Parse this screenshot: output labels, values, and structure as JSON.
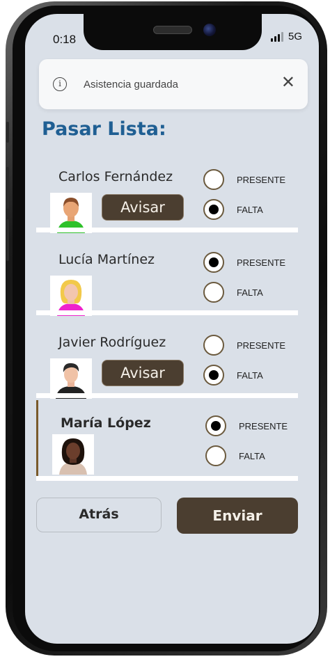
{
  "status_bar": {
    "time": "0:18",
    "network": "5G"
  },
  "toast": {
    "message": "Asistencia guardada",
    "info_glyph": "i",
    "close_glyph": "✕"
  },
  "page_title": "Pasar Lista:",
  "option_labels": {
    "present": "PRESENTE",
    "absent": "FALTA"
  },
  "students": [
    {
      "name": "Carlos Fernández",
      "status": "FALTA",
      "notify_label": "Avisar",
      "avatar": "boy-green-shirt-avatar"
    },
    {
      "name": "Lucía Martínez",
      "status": "PRESENTE",
      "avatar": "girl-blonde-pink-shirt-avatar"
    },
    {
      "name": "Javier Rodríguez",
      "status": "FALTA",
      "notify_label": "Avisar",
      "avatar": "boy-dark-hair-black-shirt-avatar"
    },
    {
      "name": "María López",
      "status": "PRESENTE",
      "avatar": "girl-dark-skin-avatar"
    }
  ],
  "buttons": {
    "back": "Atrás",
    "send": "Enviar"
  },
  "colors": {
    "title": "#1f5f93",
    "primary_button": "#4b3e30",
    "screen_bg": "#dae0e8",
    "highlight_border": "#7a5a2a"
  }
}
